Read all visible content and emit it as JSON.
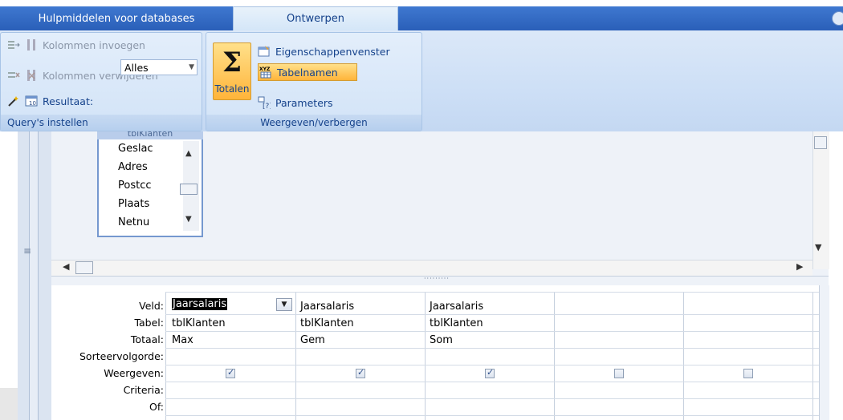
{
  "tabs": {
    "contextual_label": "Hulpmiddelen voor databases",
    "design_label": "Ontwerpen"
  },
  "ribbon": {
    "query_setup": {
      "insert_columns": "Kolommen invoegen",
      "delete_columns": "Kolommen verwijderen",
      "result_label": "Resultaat:",
      "result_value": "Alles",
      "group_label": "Query's instellen"
    },
    "show_hide": {
      "totals_label": "Totalen",
      "property_sheet": "Eigenschappenvenster",
      "table_names": "Tabelnamen",
      "parameters": "Parameters",
      "group_label": "Weergeven/verbergen"
    }
  },
  "field_list": {
    "title": "tblKlanten",
    "fields": [
      "Geslac",
      "Adres",
      "Postcc",
      "Plaats",
      "Netnu"
    ]
  },
  "grid": {
    "row_labels": [
      "Veld:",
      "Tabel:",
      "Totaal:",
      "Sorteervolgorde:",
      "Weergeven:",
      "Criteria:",
      "Of:"
    ],
    "columns": [
      {
        "veld": "Jaarsalaris",
        "tabel": "tblKlanten",
        "totaal": "Max",
        "weergeven": true
      },
      {
        "veld": "Jaarsalaris",
        "tabel": "tblKlanten",
        "totaal": "Gem",
        "weergeven": true
      },
      {
        "veld": "Jaarsalaris",
        "tabel": "tblKlanten",
        "totaal": "Som",
        "weergeven": true
      },
      {
        "veld": "",
        "tabel": "",
        "totaal": "",
        "weergeven": false
      },
      {
        "veld": "",
        "tabel": "",
        "totaal": "",
        "weergeven": false
      }
    ]
  }
}
